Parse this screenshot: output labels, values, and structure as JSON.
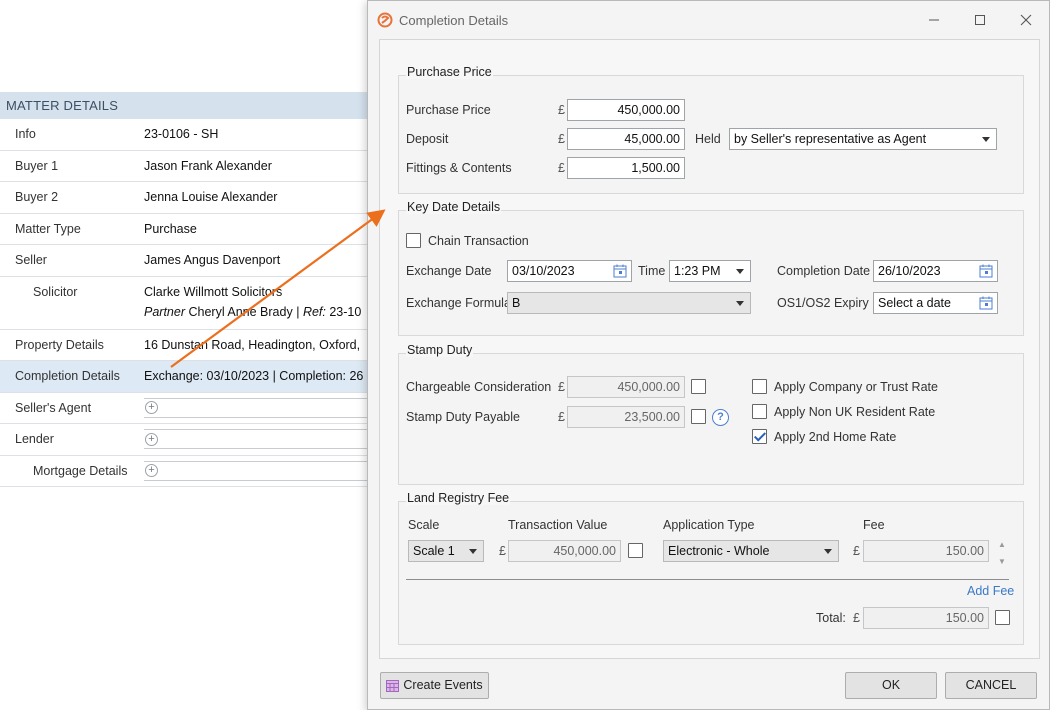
{
  "matter": {
    "header": "MATTER DETAILS",
    "rows": [
      {
        "label": "Info",
        "value": "23-0106 - SH"
      },
      {
        "label": "Buyer 1",
        "value": "Jason Frank Alexander"
      },
      {
        "label": "Buyer 2",
        "value": "Jenna Louise Alexander"
      },
      {
        "label": "Matter Type",
        "value": "Purchase"
      },
      {
        "label": "Seller",
        "value": "James Angus Davenport"
      },
      {
        "label": "Solicitor",
        "value": "Clarke Willmott Solicitors",
        "role": "Partner",
        "contact": "Cheryl Anne Brady",
        "sep": "|",
        "ref_label": "Ref:",
        "ref_value": "23-10"
      },
      {
        "label": "Property Details",
        "value": "16 Dunstan Road, Headington, Oxford,"
      },
      {
        "label": "Completion Details",
        "value": "Exchange: 03/10/2023 | Completion: 26"
      },
      {
        "label": "Seller's Agent",
        "value": ""
      },
      {
        "label": "Lender",
        "value": ""
      },
      {
        "label": "Mortgage Details",
        "value": ""
      }
    ]
  },
  "dialog": {
    "title": "Completion Details",
    "icons": {
      "logo": "app-logo-icon",
      "minimize": "minimize-icon",
      "maximize": "maximize-icon",
      "close": "close-icon"
    },
    "purchase_price": {
      "group_label": "Purchase Price",
      "currency": "£",
      "price_label": "Purchase Price",
      "price_value": "450,000.00",
      "deposit_label": "Deposit",
      "deposit_value": "45,000.00",
      "held_label": "Held",
      "held_value": "by Seller's representative as Agent",
      "fittings_label": "Fittings & Contents",
      "fittings_value": "1,500.00"
    },
    "key_dates": {
      "group_label": "Key Date Details",
      "chain_label": "Chain Transaction",
      "chain_checked": false,
      "exchange_label": "Exchange Date",
      "exchange_value": "03/10/2023",
      "time_label": "Time",
      "time_value": "1:23 PM",
      "completion_label": "Completion Date",
      "completion_value": "26/10/2023",
      "formula_label": "Exchange Formula",
      "formula_value": "B",
      "os_label": "OS1/OS2 Expiry",
      "os_placeholder": "Select a date"
    },
    "stamp_duty": {
      "group_label": "Stamp Duty",
      "consideration_label": "Chargeable Consideration",
      "consideration_value": "450,000.00",
      "payable_label": "Stamp Duty Payable",
      "payable_value": "23,500.00",
      "help": "?",
      "company_rate_label": "Apply Company or Trust Rate",
      "company_rate_checked": false,
      "nonuk_rate_label": "Apply Non UK Resident Rate",
      "nonuk_rate_checked": false,
      "second_home_label": "Apply 2nd Home Rate",
      "second_home_checked": true
    },
    "land_registry": {
      "group_label": "Land Registry Fee",
      "col_scale": "Scale",
      "col_value": "Transaction Value",
      "col_type": "Application Type",
      "col_fee": "Fee",
      "scale_value": "Scale 1",
      "transaction_value": "450,000.00",
      "type_value": "Electronic - Whole",
      "fee_value": "150.00",
      "add_fee": "Add Fee",
      "total_label": "Total:",
      "total_value": "150.00"
    },
    "buttons": {
      "create_events": "Create Events",
      "ok": "OK",
      "cancel": "CANCEL"
    },
    "accent": "#3a78c9",
    "arrow_color": "#ec6f1d"
  }
}
